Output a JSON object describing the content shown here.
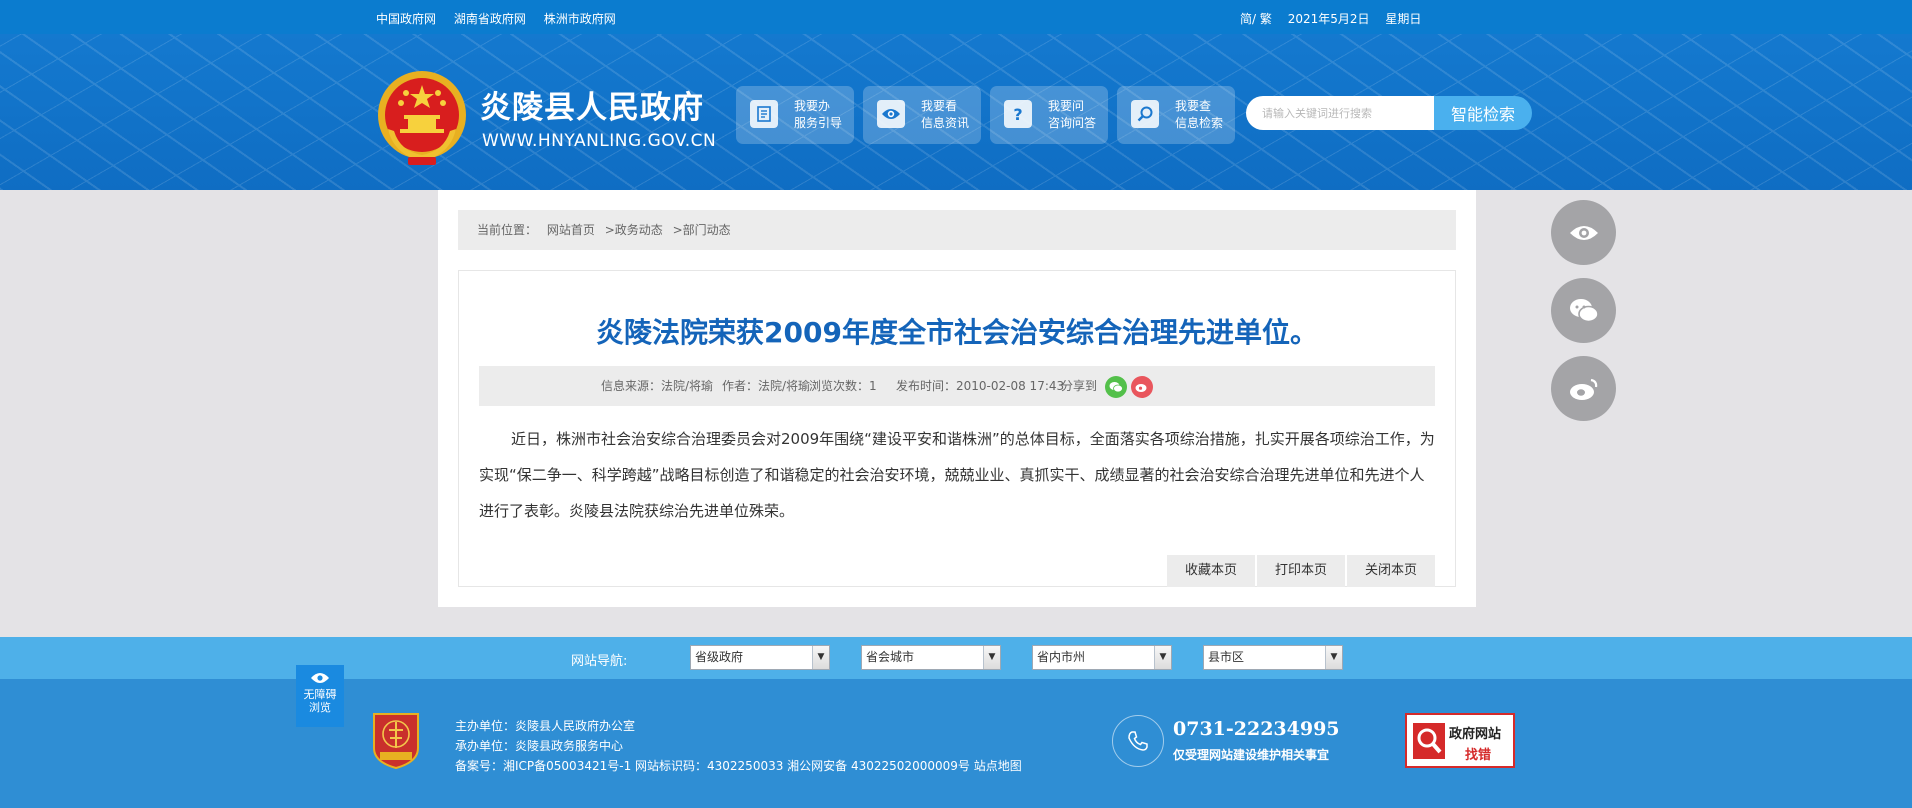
{
  "topbar": {
    "links": [
      "中国政府网",
      "湖南省政府网",
      "株洲市政府网"
    ],
    "lang_toggle": "简/ 繁",
    "date": "2021年5月2日",
    "weekday": "星期日"
  },
  "header": {
    "title": "炎陵县人民政府",
    "url": "WWW.HNYANLING.GOV.CN",
    "services": [
      {
        "line1": "我要办",
        "line2": "服务引导",
        "icon": "document-icon"
      },
      {
        "line1": "我要看",
        "line2": "信息资讯",
        "icon": "eye-icon"
      },
      {
        "line1": "我要问",
        "line2": "咨询问答",
        "icon": "question-icon"
      },
      {
        "line1": "我要查",
        "line2": "信息检索",
        "icon": "search-icon"
      }
    ],
    "search": {
      "placeholder": "请输入关键词进行搜索",
      "button": "智能检索"
    }
  },
  "breadcrumb": {
    "prefix": "当前位置：",
    "items": [
      "网站首页",
      ">政务动态",
      ">部门动态"
    ]
  },
  "article": {
    "title": "炎陵法院荣获2009年度全市社会治安综合治理先进单位。",
    "meta": {
      "source": "信息来源：法院/将瑜",
      "author": "作者：法院/将瑜",
      "views": "浏览次数：1",
      "published": "发布时间：2010-02-08 17:43",
      "share_label": "分享到"
    },
    "body": "近日，株洲市社会治安综合治理委员会对2009年围绕“建设平安和谐株洲”的总体目标，全面落实各项综治措施，扎实开展各项综治工作，为实现“保二争一、科学跨越”战略目标创造了和谐稳定的社会治安环境，兢兢业业、真抓实干、成绩显著的社会治安综合治理先进单位和先进个人进行了表彰。炎陵县法院获综治先进单位殊荣。",
    "actions": [
      "收藏本页",
      "打印本页",
      "关闭本页"
    ]
  },
  "float_icons": [
    "eye-icon",
    "wechat-icon",
    "weibo-icon"
  ],
  "footer_nav": {
    "label": "网站导航:",
    "selects": [
      "省级政府",
      "省会城市",
      "省内市州",
      "县市区"
    ]
  },
  "accessibility": {
    "line1": "无障碍",
    "line2": "浏览"
  },
  "footer": {
    "host": "主办单位：炎陵县人民政府办公室",
    "organizer": "承办单位：炎陵县政务服务中心",
    "record": "备案号：湘ICP备05003421号-1 网站标识码：4302250033 湘公网安备 43022502000009号 站点地图",
    "phone": "0731-22234995",
    "phone_note": "仅受理网站建设维护相关事宜",
    "error_box": {
      "line1": "政府网站",
      "line2": "找错"
    }
  }
}
